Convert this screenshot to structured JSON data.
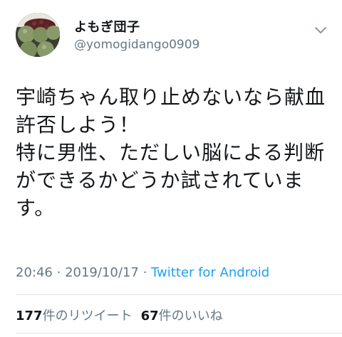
{
  "user": {
    "display_name": "よもぎ団子",
    "handle": "@yomogidango0909"
  },
  "tweet": {
    "text": "宇崎ちゃん取り止めないなら献血許否しよう！\n特に男性、ただしい脳による判断ができるかどうか試されています。",
    "time": "20:46",
    "date": "2019/10/17",
    "separator": "·",
    "source": "Twitter for Android"
  },
  "stats": {
    "retweets_count": "177",
    "retweets_label": "件のリツイート",
    "likes_count": "67",
    "likes_label": "件のいいね"
  },
  "icons": {
    "avatar": "yomogi-dango-photo",
    "menu": "chevron-down-icon"
  }
}
